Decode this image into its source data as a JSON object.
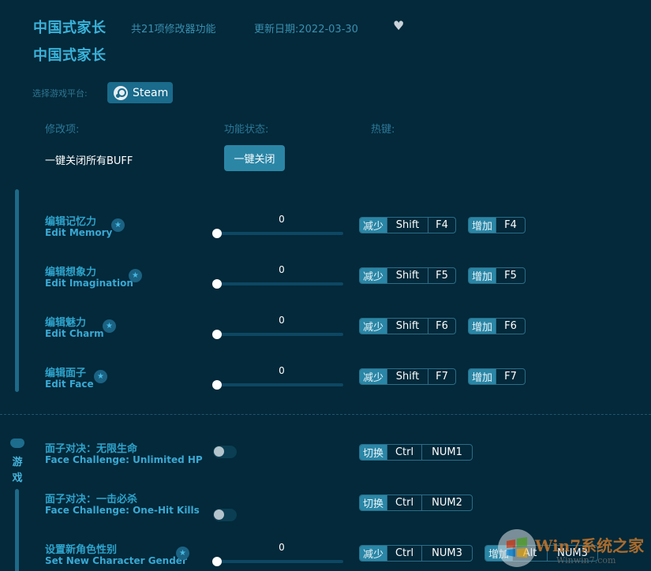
{
  "header": {
    "game_title": "中国式家长",
    "subtitle": "中国式家长",
    "feature_count": "共21项修改器功能",
    "update_date": "更新日期:2022-03-30",
    "favorite_icon": "heart-icon"
  },
  "platform": {
    "label": "选择游戏平台:",
    "selected": "Steam",
    "icon": "steam-icon"
  },
  "columns": {
    "item": "修改项:",
    "status": "功能状态:",
    "hotkey": "热键:"
  },
  "close_all": {
    "label": "一键关闭所有BUFF",
    "button": "一键关闭"
  },
  "sliders": [
    {
      "cn": "编辑记忆力",
      "en": "Edit Memory",
      "value": "0",
      "dec": [
        "减少",
        "Shift",
        "F4"
      ],
      "inc": [
        "增加",
        "F4"
      ]
    },
    {
      "cn": "编辑想象力",
      "en": "Edit Imagination",
      "value": "0",
      "dec": [
        "减少",
        "Shift",
        "F5"
      ],
      "inc": [
        "增加",
        "F5"
      ]
    },
    {
      "cn": "编辑魅力",
      "en": "Edit Charm",
      "value": "0",
      "dec": [
        "减少",
        "Shift",
        "F6"
      ],
      "inc": [
        "增加",
        "F6"
      ]
    },
    {
      "cn": "编辑面子",
      "en": "Edit Face",
      "value": "0",
      "dec": [
        "减少",
        "Shift",
        "F7"
      ],
      "inc": [
        "增加",
        "F7"
      ]
    }
  ],
  "game_section": {
    "tab_label_1": "游",
    "tab_label_2": "戏",
    "toggles": [
      {
        "cn": "面子对决：无限生命",
        "en": "Face Challenge: Unlimited HP",
        "on": false,
        "hk": [
          "切换",
          "Ctrl",
          "NUM1"
        ]
      },
      {
        "cn": "面子对决：一击必杀",
        "en": "Face Challenge: One-Hit Kills",
        "on": false,
        "hk": [
          "切换",
          "Ctrl",
          "NUM2"
        ]
      }
    ],
    "gender": {
      "cn": "设置新角色性别",
      "en": "Set New Character Gender",
      "value": "0",
      "dec": [
        "减少",
        "Ctrl",
        "NUM3"
      ],
      "inc": [
        "增加",
        "Alt",
        "NUM3"
      ]
    }
  },
  "watermark": {
    "brand": "Win7系统之家",
    "url": "Winwin7.com"
  }
}
